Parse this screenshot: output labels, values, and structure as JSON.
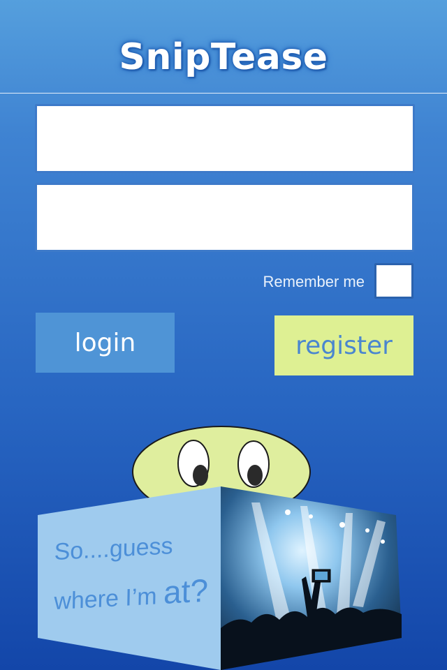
{
  "app": {
    "title": "SnipTease"
  },
  "form": {
    "username": {
      "value": "",
      "placeholder": ""
    },
    "password": {
      "value": "",
      "placeholder": ""
    },
    "remember_label": "Remember me",
    "remember_checked": false
  },
  "buttons": {
    "login": "login",
    "register": "register"
  },
  "mascot": {
    "line1": "So....guess",
    "line2_a": "where I’m ",
    "line2_b": "at?"
  },
  "colors": {
    "login_button": "#4f94d6",
    "register_button": "#def093",
    "register_text": "#4a86cf",
    "mascot_face": "#dfee9e",
    "box_side": "#9fcbee",
    "box_text": "#4c8fd8"
  }
}
